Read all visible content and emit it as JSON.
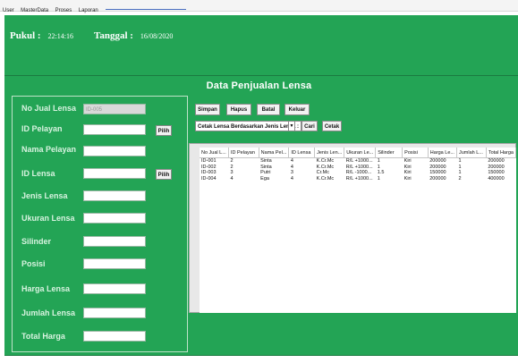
{
  "menu": [
    "User",
    "MasterData",
    "Proses",
    "Laporan"
  ],
  "header": {
    "time_label": "Pukul :",
    "time_value": "22:14:16",
    "date_label": "Tanggal :",
    "date_value": "16/08/2020"
  },
  "title": "Data Penjualan Lensa",
  "form": {
    "fields": [
      {
        "label": "No Jual Lensa",
        "value": "ID-005"
      },
      {
        "label": "ID Pelayan",
        "value": ""
      },
      {
        "label": "Nama Pelayan",
        "value": ""
      },
      {
        "label": "ID Lensa",
        "value": ""
      },
      {
        "label": "Jenis Lensa",
        "value": ""
      },
      {
        "label": "Ukuran Lensa",
        "value": ""
      },
      {
        "label": "Silinder",
        "value": ""
      },
      {
        "label": "Posisi",
        "value": ""
      },
      {
        "label": "Harga Lensa",
        "value": ""
      },
      {
        "label": "Jumlah Lensa",
        "value": ""
      },
      {
        "label": "Total Harga",
        "value": ""
      }
    ],
    "pilih_label": "Pilih"
  },
  "actions": {
    "simpan": "Simpan",
    "hapus": "Hapus",
    "batal": "Batal",
    "keluar": "Keluar",
    "cetak_combo": "Cetak Lensa Berdasarkan Jenis Lensa :",
    "cari": "Cari",
    "cetak": "Cetak"
  },
  "table": {
    "columns": [
      "No Jual L...",
      "ID Pelayan",
      "Nama Pel...",
      "ID Lensa",
      "Jenis Len...",
      "Ukuran Le...",
      "Silinder",
      "Posisi",
      "Harga Le...",
      "Jumlah L...",
      "Total Harga"
    ],
    "rows": [
      [
        "ID-001",
        "2",
        "Sinta",
        "4",
        "K.Cr.Mc",
        "R/L +1000...",
        "1",
        "Kiri",
        "200000",
        "1",
        "200000"
      ],
      [
        "ID-002",
        "2",
        "Sinta",
        "4",
        "K.Cr.Mc",
        "R/L +1000...",
        "1",
        "Kiri",
        "200000",
        "1",
        "200000"
      ],
      [
        "ID-003",
        "3",
        "Putri",
        "3",
        "Cr.Mc",
        "R/L -1000...",
        "1.5",
        "Kiri",
        "150000",
        "1",
        "150000"
      ],
      [
        "ID-004",
        "4",
        "Ega",
        "4",
        "K.Cr.Mc",
        "R/L +1000...",
        "1",
        "Kiri",
        "200000",
        "2",
        "400000"
      ]
    ]
  }
}
